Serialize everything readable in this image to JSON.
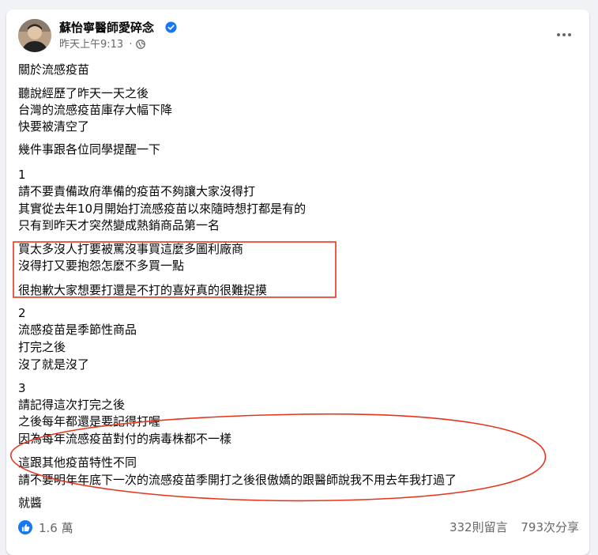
{
  "post": {
    "author": "蘇怡寧醫師愛碎念",
    "timestamp": "昨天上午9:13",
    "separator": "·",
    "privacy_icon": "globe-icon",
    "lines": [
      "關於流感疫苗",
      "聽說經歷了昨天一天之後",
      "台灣的流感疫苗庫存大幅下降",
      "快要被清空了",
      "幾件事跟各位同學提醒一下",
      "1",
      "請不要責備政府準備的疫苗不夠讓大家沒得打",
      "其實從去年10月開始打流感疫苗以來隨時想打都是有的",
      "只有到昨天才突然變成熱銷商品第一名",
      "買太多沒人打要被罵沒事買這麼多圖利廠商",
      "沒得打又要抱怨怎麼不多買一點",
      "很抱歉大家想要打還是不打的喜好真的很難捉摸",
      "2",
      "流感疫苗是季節性商品",
      "打完之後",
      "沒了就是沒了",
      "3",
      "請記得這次打完之後",
      "之後每年都還是要記得打喔",
      "因為每年流感疫苗對付的病毒株都不一樣",
      "這跟其他疫苗特性不同",
      "請不要明年年底下一次的流感疫苗季開打之後很傲嬌的跟醫師說我不用去年我打過了",
      "就醬"
    ]
  },
  "footer": {
    "reactions_count": "1.6 萬",
    "comments": "332則留言",
    "shares": "793次分享"
  },
  "colors": {
    "accent": "#1877f2",
    "annotation": "#e8341c",
    "secondary_text": "#65676b"
  }
}
